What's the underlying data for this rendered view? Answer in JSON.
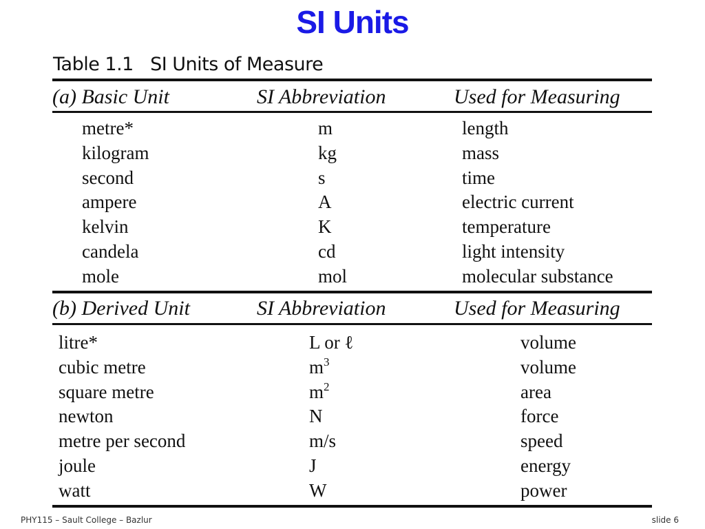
{
  "slide": {
    "title": "SI Units",
    "title_color": "#1a1ae6"
  },
  "table": {
    "caption": "Table 1.1   SI Units of Measure",
    "section_a": {
      "headers": [
        "(a) Basic Unit",
        "SI Abbreviation",
        "Used for Measuring"
      ],
      "rows": [
        {
          "unit": "metre*",
          "abbr": "m",
          "measures": "length"
        },
        {
          "unit": "kilogram",
          "abbr": "kg",
          "measures": "mass"
        },
        {
          "unit": "second",
          "abbr": "s",
          "measures": "time"
        },
        {
          "unit": "ampere",
          "abbr": "A",
          "measures": "electric current"
        },
        {
          "unit": "kelvin",
          "abbr": "K",
          "measures": "temperature"
        },
        {
          "unit": "candela",
          "abbr": "cd",
          "measures": "light intensity"
        },
        {
          "unit": "mole",
          "abbr": "mol",
          "measures": "molecular substance"
        }
      ]
    },
    "section_b": {
      "headers": [
        "(b) Derived Unit",
        "SI Abbreviation",
        "Used for Measuring"
      ],
      "rows": [
        {
          "unit": "litre*",
          "abbr": "L or ℓ",
          "abbr_sup": "",
          "measures": "volume"
        },
        {
          "unit": "cubic metre",
          "abbr": "m",
          "abbr_sup": "3",
          "measures": "volume"
        },
        {
          "unit": "square metre",
          "abbr": "m",
          "abbr_sup": "2",
          "measures": "area"
        },
        {
          "unit": "newton",
          "abbr": "N",
          "abbr_sup": "",
          "measures": "force"
        },
        {
          "unit": "metre per second",
          "abbr": "m/s",
          "abbr_sup": "",
          "measures": "speed"
        },
        {
          "unit": "joule",
          "abbr": "J",
          "abbr_sup": "",
          "measures": "energy"
        },
        {
          "unit": "watt",
          "abbr": "W",
          "abbr_sup": "",
          "measures": "power"
        }
      ]
    }
  },
  "footer": {
    "left": "PHY115 – Sault College – Bazlur",
    "right": "slide 6"
  }
}
